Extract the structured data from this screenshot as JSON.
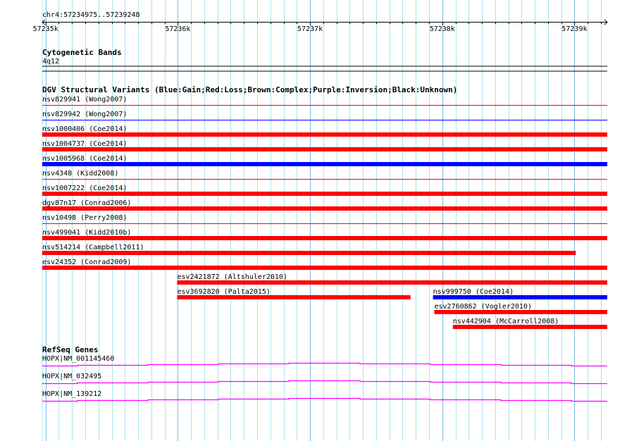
{
  "view": {
    "chrom": "chr4",
    "start": 57234975,
    "end": 57239248,
    "title": "chr4:57234975..57239248"
  },
  "ruler": {
    "major_ticks": [
      {
        "pos": 57235000,
        "label": "57235k"
      },
      {
        "pos": 57236000,
        "label": "57236k"
      },
      {
        "pos": 57237000,
        "label": "57237k"
      },
      {
        "pos": 57238000,
        "label": "57238k"
      },
      {
        "pos": 57239000,
        "label": "57239k"
      }
    ],
    "minor_step_bp": 100
  },
  "colors": {
    "grid": "#a8e4ee",
    "grid_major": "#7ab8e0",
    "loss": "#ff0000",
    "gain": "#0000ff",
    "gene": "#ff00ff"
  },
  "cyto": {
    "title": "Cytogenetic Bands",
    "band": "4q12"
  },
  "dgv": {
    "title": "DGV Structural Variants (Blue:Gain;Red:Loss;Brown:Complex;Purple:Inversion;Black:Unknown)",
    "rows": [
      [
        {
          "label": "nsv829941 (Wong2007)",
          "type": "loss",
          "style": "thin",
          "start": 57234975,
          "end": 57239248
        }
      ],
      [
        {
          "label": "nsv829942 (Wong2007)",
          "type": "gain",
          "style": "thin",
          "start": 57234975,
          "end": 57239248
        }
      ],
      [
        {
          "label": "nsv1000406 (Coe2014)",
          "type": "loss",
          "style": "thick",
          "start": 57234975,
          "end": 57239248
        }
      ],
      [
        {
          "label": "nsv1004737 (Coe2014)",
          "type": "loss",
          "style": "thick",
          "start": 57234975,
          "end": 57239248
        }
      ],
      [
        {
          "label": "nsv1005968 (Coe2014)",
          "type": "gain",
          "style": "thick",
          "start": 57234975,
          "end": 57239248
        }
      ],
      [
        {
          "label": "nsv4348 (Kidd2008)",
          "type": "loss",
          "style": "thin",
          "start": 57234975,
          "end": 57239248
        }
      ],
      [
        {
          "label": "nsv1007222 (Coe2014)",
          "type": "loss",
          "style": "thick",
          "start": 57234975,
          "end": 57239248
        }
      ],
      [
        {
          "label": "dgv87n17 (Conrad2006)",
          "type": "loss",
          "style": "thick",
          "start": 57234975,
          "end": 57239248
        }
      ],
      [
        {
          "label": "nsv10498 (Perry2008)",
          "type": "loss",
          "style": "thin",
          "start": 57234975,
          "end": 57239248
        }
      ],
      [
        {
          "label": "nsv499041 (Kidd2010b)",
          "type": "loss",
          "style": "thick",
          "start": 57234975,
          "end": 57239248
        }
      ],
      [
        {
          "label": "nsv514214 (Campbell2011)",
          "type": "loss",
          "style": "thick",
          "start": 57234975,
          "end": 57239010
        }
      ],
      [
        {
          "label": "esv24352 (Conrad2009)",
          "type": "loss",
          "style": "thick",
          "start": 57234975,
          "end": 57239248
        }
      ],
      [
        {
          "label": "esv2421872 (Altshuler2010)",
          "type": "loss",
          "style": "thick",
          "start": 57235995,
          "end": 57239248
        }
      ],
      [
        {
          "label": "esv3692820 (Palta2015)",
          "type": "loss",
          "style": "thick",
          "start": 57235995,
          "end": 57237760
        },
        {
          "label": "nsv999750 (Coe2014)",
          "type": "gain",
          "style": "thick",
          "start": 57237930,
          "end": 57239248
        }
      ],
      [
        {
          "label": "esv2760862 (Vogler2010)",
          "type": "loss",
          "style": "thick",
          "start": 57237940,
          "end": 57239248
        }
      ],
      [
        {
          "label": "nsv442904 (McCarroll2008)",
          "type": "loss",
          "style": "thick",
          "start": 57238080,
          "end": 57239248
        }
      ]
    ]
  },
  "refseq": {
    "title": "RefSeq Genes",
    "genes": [
      {
        "label": "HOPX|NM_001145460",
        "start": 57234975,
        "end": 57239248
      },
      {
        "label": "HOPX|NM_032495",
        "start": 57234975,
        "end": 57239248
      },
      {
        "label": "HOPX|NM_139212",
        "start": 57234975,
        "end": 57239248
      }
    ]
  }
}
